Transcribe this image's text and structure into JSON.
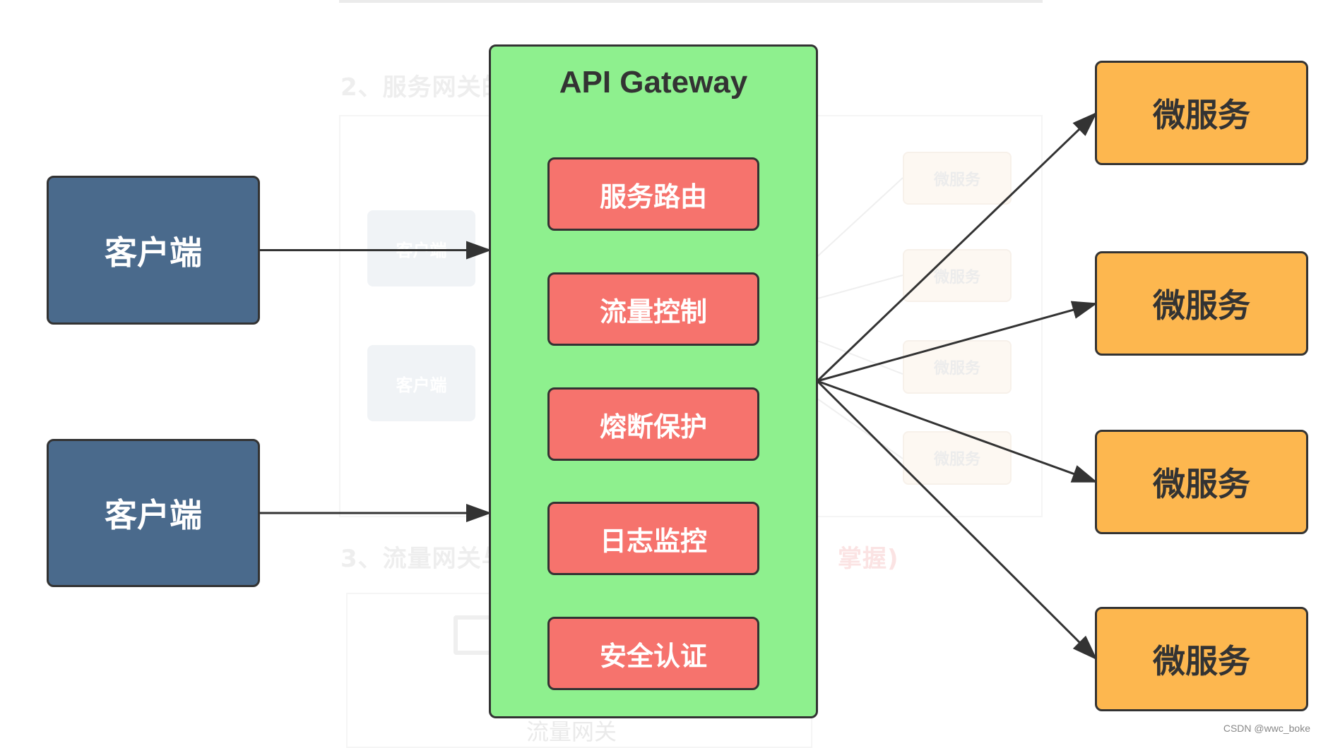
{
  "background": {
    "heading_2": "2、服务网关的",
    "heading_3_left": "3、流量网关与",
    "heading_3_right": "掌握)",
    "faint_clients": [
      "客户端",
      "客户端"
    ],
    "faint_microservices": [
      "微服务",
      "微服务",
      "微服务",
      "微服务"
    ],
    "bottom_label": "流量网关"
  },
  "diagram": {
    "clients": [
      {
        "label": "客户端"
      },
      {
        "label": "客户端"
      }
    ],
    "gateway": {
      "title": "API Gateway",
      "modules": [
        {
          "label": "服务路由"
        },
        {
          "label": "流量控制"
        },
        {
          "label": "熔断保护"
        },
        {
          "label": "日志监控"
        },
        {
          "label": "安全认证"
        }
      ]
    },
    "microservices": [
      {
        "label": "微服务"
      },
      {
        "label": "微服务"
      },
      {
        "label": "微服务"
      },
      {
        "label": "微服务"
      }
    ],
    "edges": [
      {
        "from": "client-1",
        "to": "gateway"
      },
      {
        "from": "client-2",
        "to": "gateway"
      },
      {
        "from": "gateway",
        "to": "microservice-1"
      },
      {
        "from": "gateway",
        "to": "microservice-2"
      },
      {
        "from": "gateway",
        "to": "microservice-3"
      },
      {
        "from": "gateway",
        "to": "microservice-4"
      }
    ],
    "colors": {
      "client": "#4a6a8c",
      "gateway": "#8ef08e",
      "module": "#f6736d",
      "microservice": "#fdb74f",
      "stroke": "#333333"
    }
  },
  "watermark": "CSDN @wwc_boke"
}
